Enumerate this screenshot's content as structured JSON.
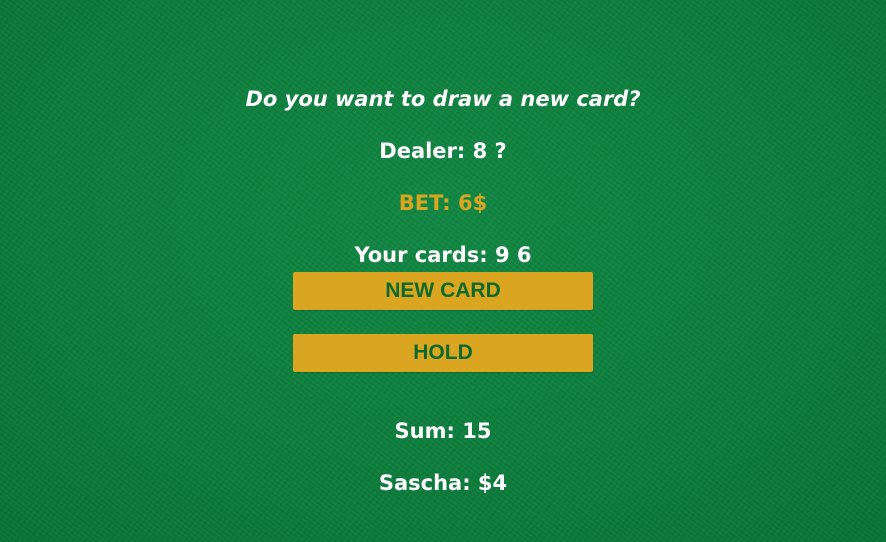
{
  "game": {
    "message": "Do you want to draw a new card?",
    "dealer_text": "Dealer: 8 ?",
    "bet_text": "BET: 6$",
    "cards_text": "Your cards: 9 6",
    "sum_text": "Sum: 15",
    "player_text": "Sascha: $4"
  },
  "buttons": {
    "new_card_label": "NEW CARD",
    "hold_label": "HOLD"
  },
  "colors": {
    "felt": "#0b7f3c",
    "button": "#daa520",
    "button_text": "#0e6a2c",
    "bet_text": "#daa520",
    "text": "#ffffff"
  }
}
